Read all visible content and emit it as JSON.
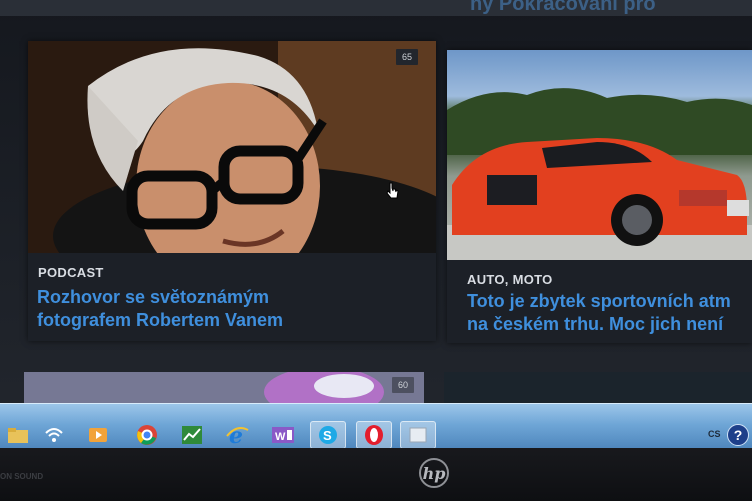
{
  "top_title": "ny Pokračování pro",
  "cards": [
    {
      "category": "PODCAST",
      "headline_line1": "Rozhovor se světoznámým",
      "headline_line2": "fotografem Robertem Vanem",
      "count": "65",
      "image": "portrait-man-glasses"
    },
    {
      "category": "AUTO, MOTO",
      "headline_line1": "Toto je zbytek sportovních atm",
      "headline_line2": "na českém trhu. Moc jich není",
      "image": "red-sports-car"
    }
  ],
  "second_row": {
    "count": "60"
  },
  "taskbar": {
    "apps": [
      {
        "name": "network-icon"
      },
      {
        "name": "media-player-icon"
      },
      {
        "name": "chrome-icon"
      },
      {
        "name": "stocks-app-icon"
      },
      {
        "name": "internet-explorer-icon"
      },
      {
        "name": "word-icon"
      },
      {
        "name": "skype-icon"
      },
      {
        "name": "opera-icon"
      },
      {
        "name": "window-switch-icon"
      }
    ],
    "language": "CS",
    "help_symbol": "?"
  },
  "bezel": {
    "sound_label": "ON SOUND",
    "brand": "hp"
  },
  "colors": {
    "headline": "#3f8fdd",
    "taskbar": "#6fa6d6",
    "car": "#e2401f"
  }
}
